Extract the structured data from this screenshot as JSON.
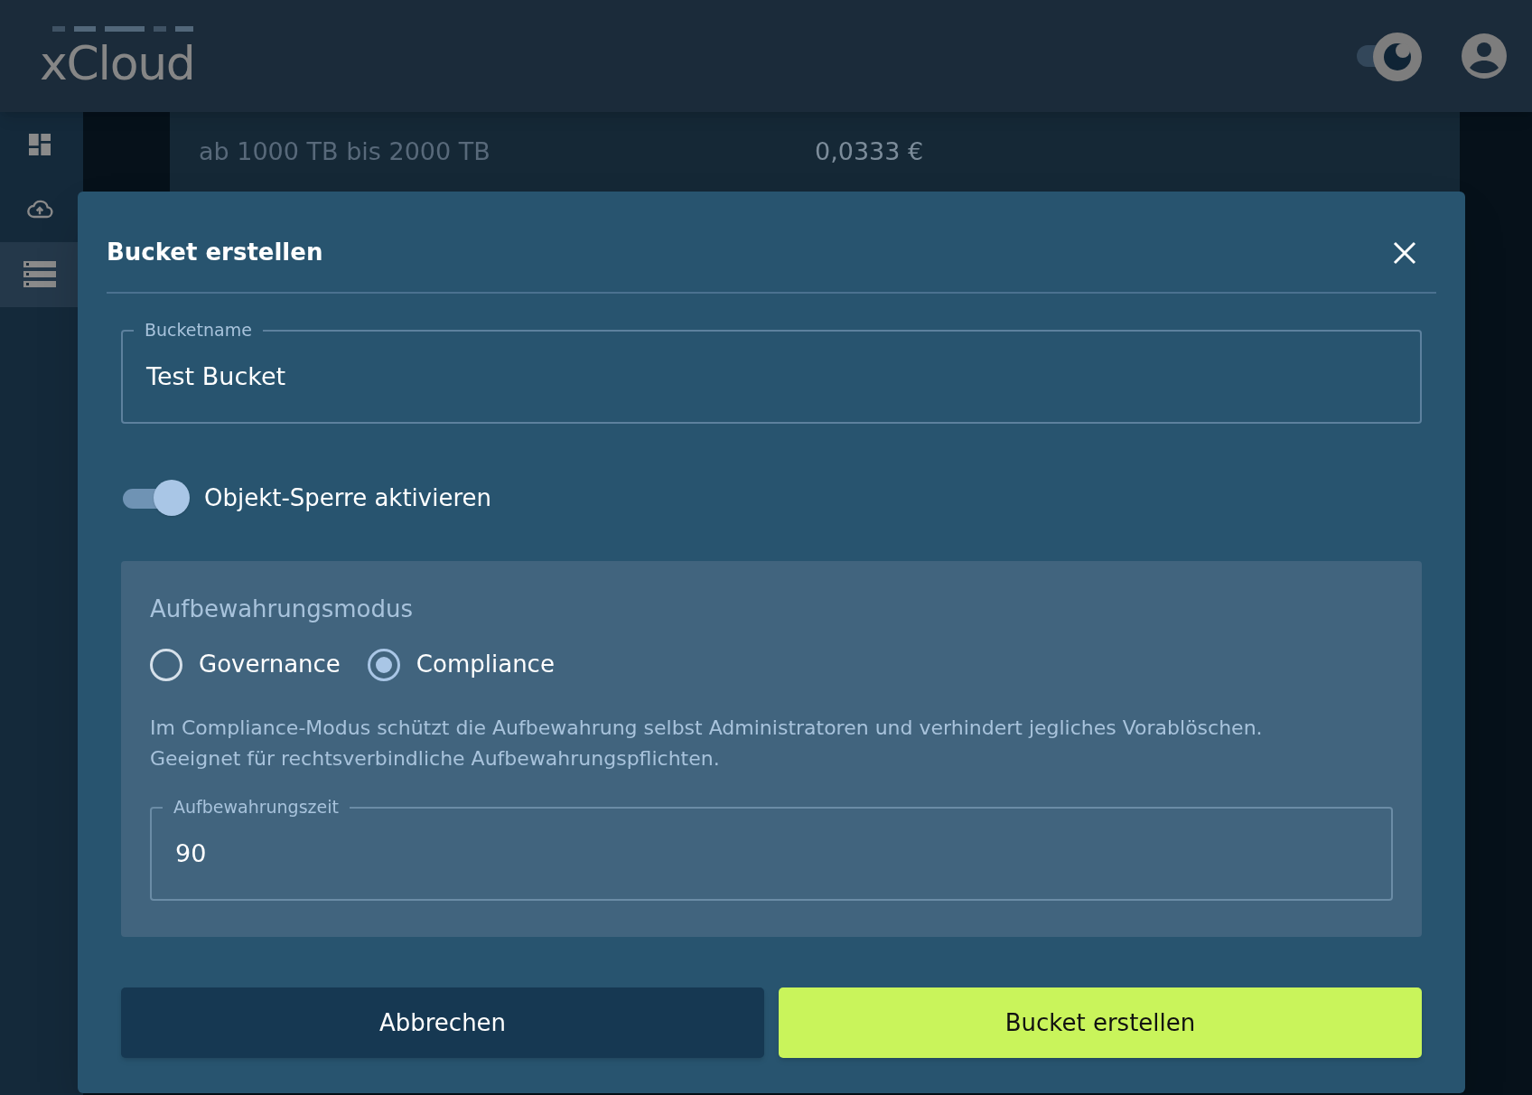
{
  "header": {
    "logo": "xCloud",
    "theme_switch": {
      "on": true
    }
  },
  "sidebar": {
    "items": [
      {
        "kind": "dashboard",
        "selected": false
      },
      {
        "kind": "upload",
        "selected": false
      },
      {
        "kind": "storage",
        "selected": true
      }
    ]
  },
  "background_row": {
    "tier": "ab 1000 TB bis 2000 TB",
    "price": "0,0333 €"
  },
  "dialog": {
    "title": "Bucket erstellen",
    "bucket_name": {
      "label": "Bucketname",
      "value": "Test Bucket"
    },
    "object_lock": {
      "label": "Objekt-Sperre aktivieren",
      "on": true
    },
    "retention": {
      "title": "Aufbewahrungsmodus",
      "options": [
        {
          "label": "Governance",
          "selected": false
        },
        {
          "label": "Compliance",
          "selected": true
        }
      ],
      "description": "Im Compliance-Modus schützt die Aufbewahrung selbst Administratoren und verhindert jegliches Vorablöschen. Geeignet für rechtsverbindliche Aufbewahrungspflichten.",
      "period": {
        "label": "Aufbewahrungszeit",
        "value": "90"
      }
    },
    "buttons": [
      {
        "label": "Abbrechen",
        "kind": "secondary"
      },
      {
        "label": "Bucket erstellen",
        "kind": "primary"
      }
    ]
  }
}
